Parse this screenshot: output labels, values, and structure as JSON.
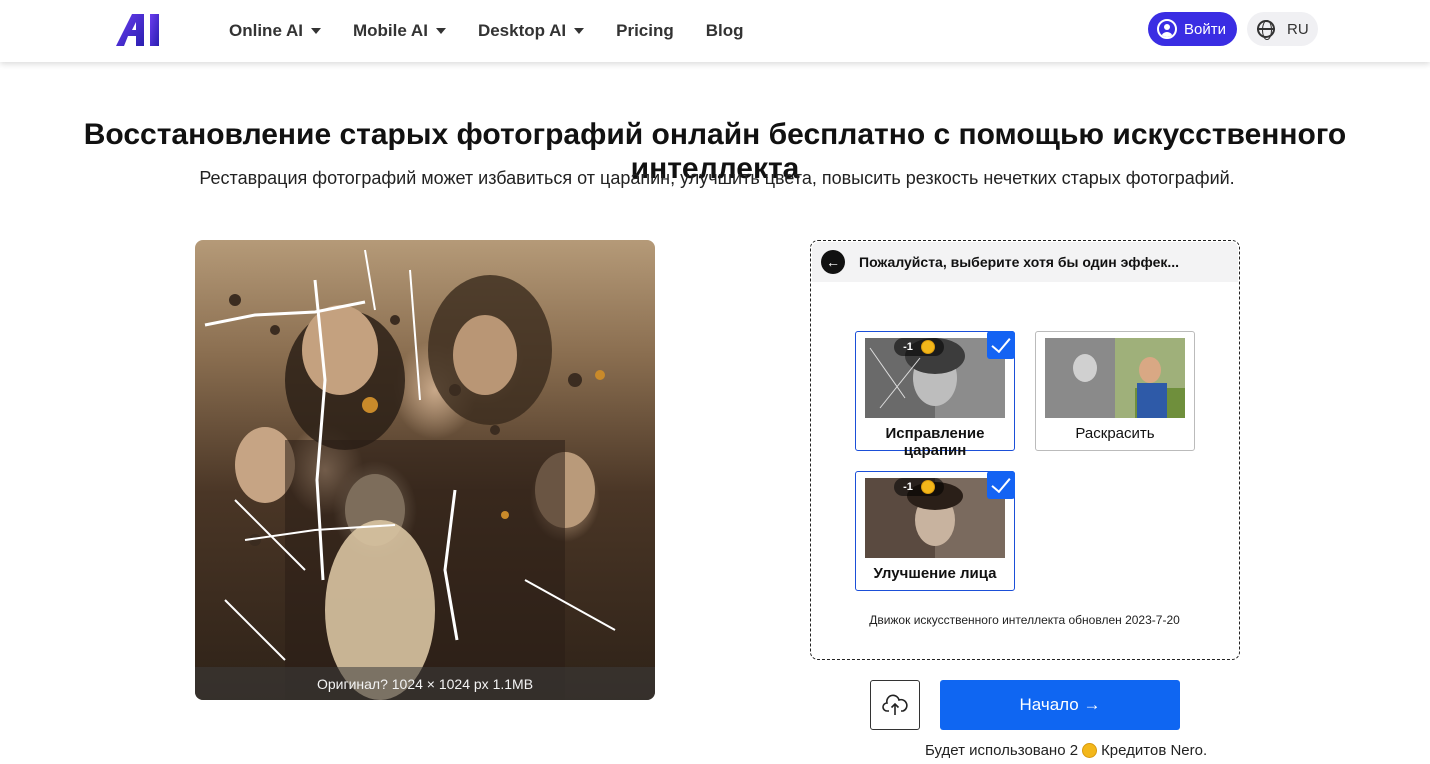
{
  "header": {
    "logo_text": "AI",
    "nav": [
      {
        "label": "Online AI",
        "dropdown": true
      },
      {
        "label": "Mobile AI",
        "dropdown": true
      },
      {
        "label": "Desktop AI",
        "dropdown": true
      },
      {
        "label": "Pricing",
        "dropdown": false
      },
      {
        "label": "Blog",
        "dropdown": false
      }
    ],
    "login_label": "Войти",
    "lang_label": "RU"
  },
  "hero": {
    "title": "Восстановление старых фотографий онлайн бесплатно с помощью искусственного интеллекта",
    "subtitle": "Реставрация фотографий может избавиться от царапин, улучшить цвета, повысить резкость нечетких старых фотографий."
  },
  "photo": {
    "caption": "Оригинал? 1024 × 1024 px 1.1MB"
  },
  "panel": {
    "header_text": "Пожалуйста, выберите хотя бы один эффек...",
    "effects": [
      {
        "label": "Исправление царапин",
        "selected": true,
        "cost": "-1"
      },
      {
        "label": "Раскрасить",
        "selected": false,
        "cost": ""
      },
      {
        "label": "Улучшение лица",
        "selected": true,
        "cost": "-1"
      }
    ],
    "engine_note": "Движок искусственного интеллекта обновлен 2023-7-20"
  },
  "actions": {
    "start_label": "Начало →",
    "credits_prefix": "Будет использовано 2",
    "credits_suffix": "Кредитов Nero."
  },
  "colors": {
    "brand": "#3a2de3",
    "accent": "#0f66f2",
    "check": "#1463f3",
    "coin": "#f3b71a"
  },
  "icons": [
    "user-icon",
    "globe-icon",
    "back-arrow-icon",
    "upload-cloud-icon",
    "coin-icon",
    "checkmark-icon",
    "caret-down-icon"
  ]
}
